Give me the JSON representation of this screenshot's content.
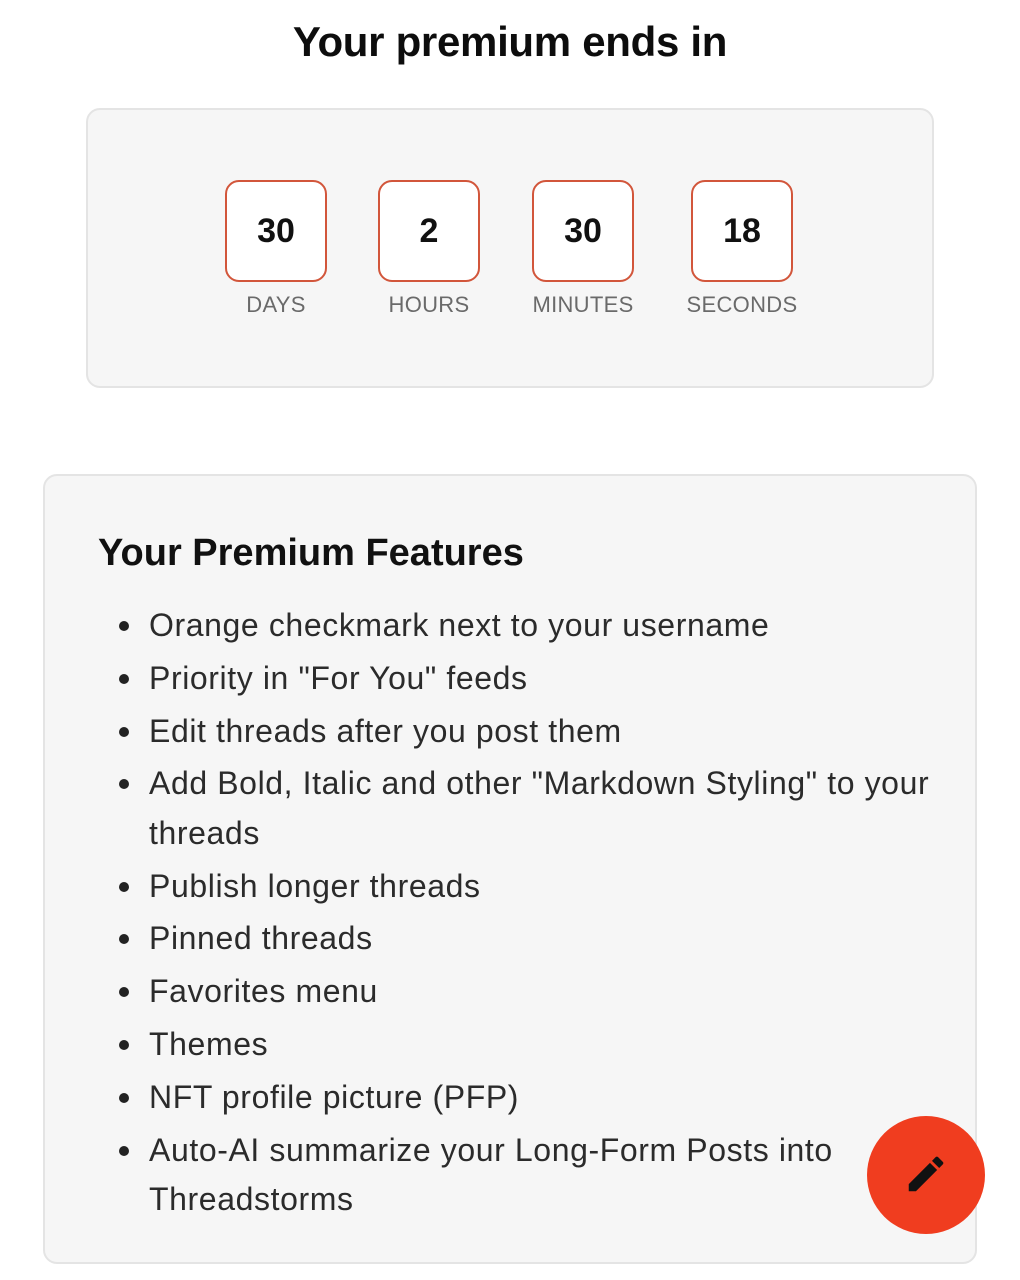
{
  "header": {
    "title": "Your premium ends in"
  },
  "countdown": [
    {
      "value": "30",
      "label": "DAYS"
    },
    {
      "value": "2",
      "label": "HOURS"
    },
    {
      "value": "30",
      "label": "MINUTES"
    },
    {
      "value": "18",
      "label": "SECONDS"
    }
  ],
  "features": {
    "title": "Your Premium Features",
    "items": [
      "Orange checkmark next to your username",
      "Priority in \"For You\" feeds",
      "Edit threads after you post them",
      "Add Bold, Italic and other \"Markdown Styling\" to your threads",
      "Publish longer threads",
      "Pinned threads",
      "Favorites menu",
      "Themes",
      "NFT profile picture (PFP)",
      "Auto-AI summarize your Long-Form Posts into Threadstorms"
    ]
  },
  "fab": {
    "icon": "pencil-icon",
    "color": "#f03d1f"
  },
  "colors": {
    "accent": "#d2563b",
    "card_bg": "#f6f6f6"
  }
}
